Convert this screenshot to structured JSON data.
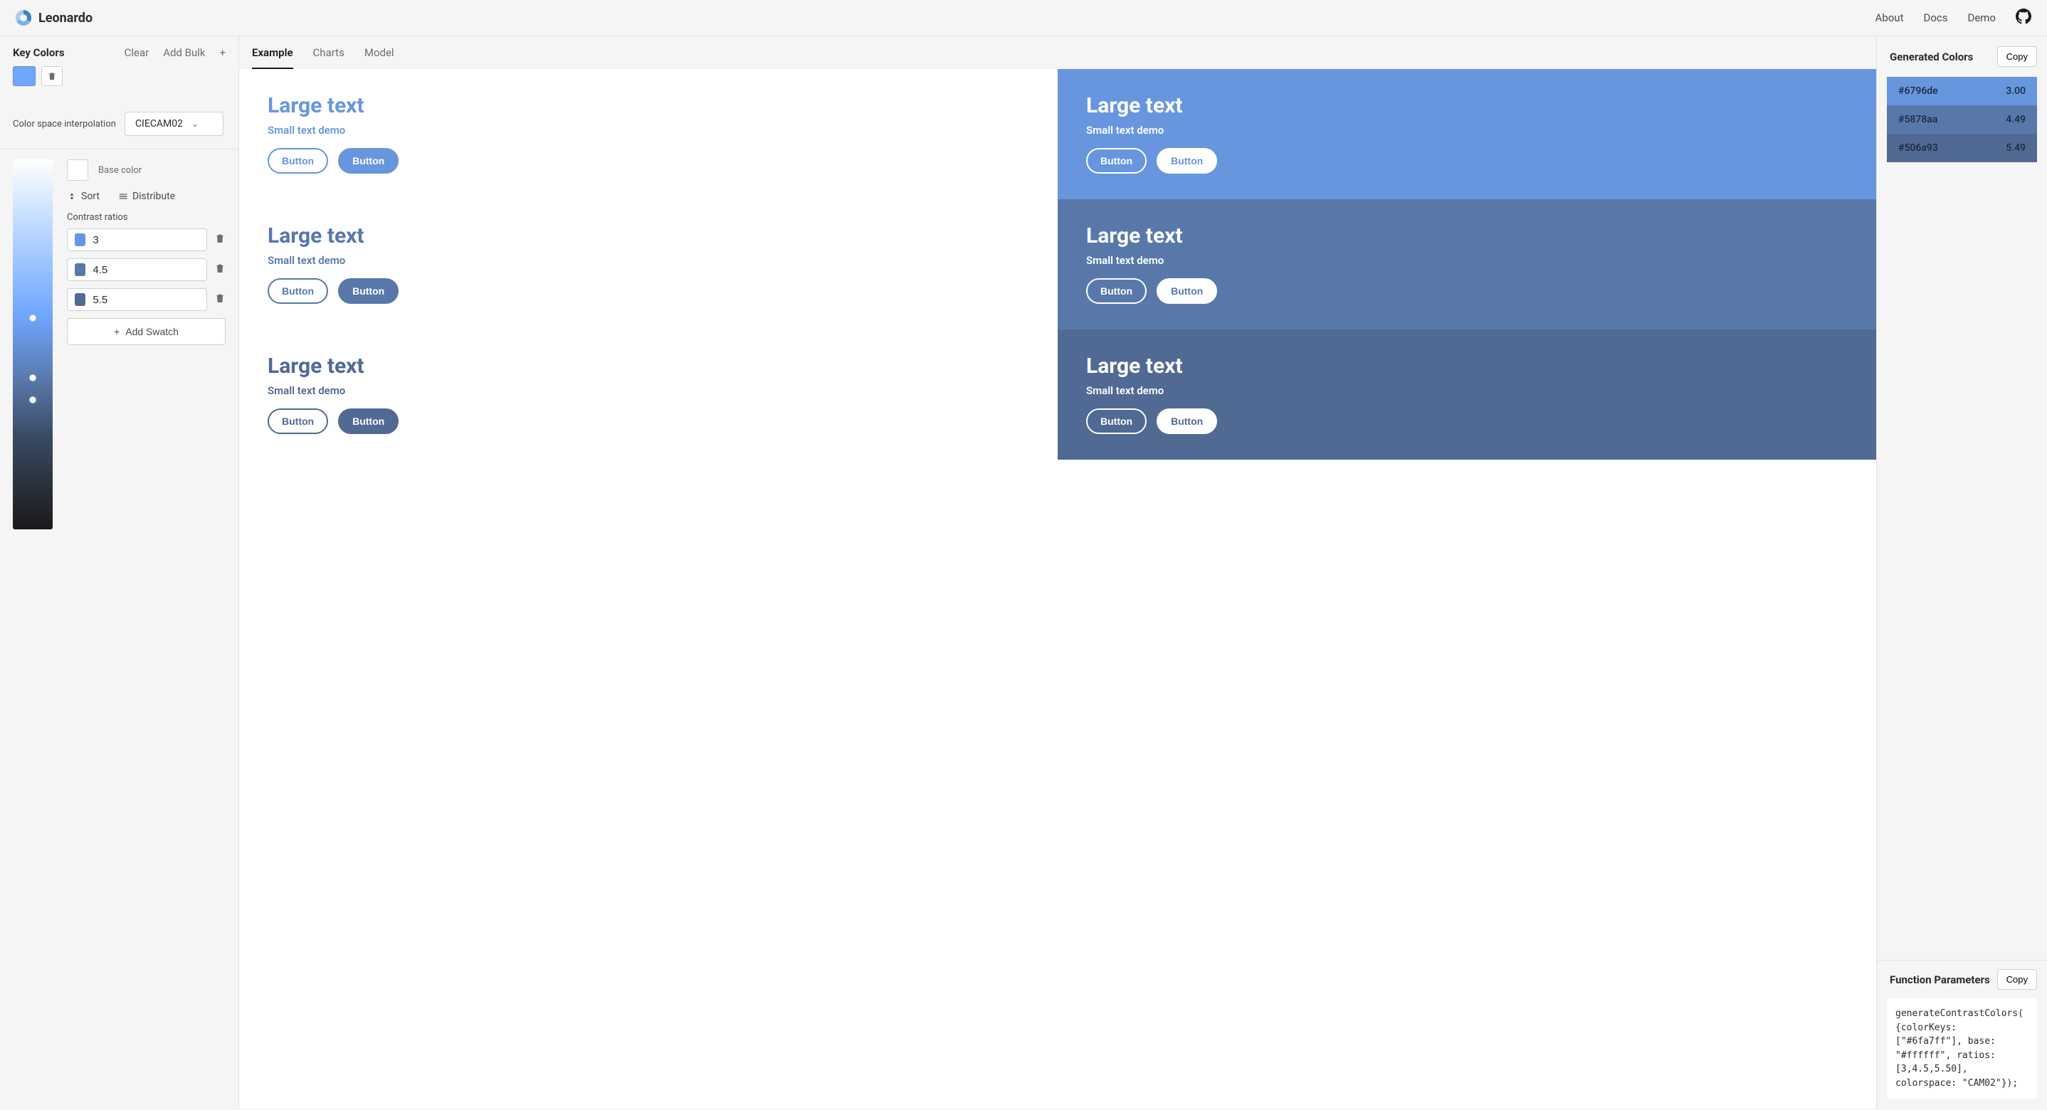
{
  "brand": {
    "name": "Leonardo"
  },
  "topnav": {
    "about": "About",
    "docs": "Docs",
    "demo": "Demo"
  },
  "keycolors": {
    "title": "Key Colors",
    "clear": "Clear",
    "add_bulk": "Add Bulk",
    "swatch_color": "#6fa7ff"
  },
  "colorspace": {
    "label": "Color space interpolation",
    "value": "CIECAM02"
  },
  "base": {
    "label": "Base color",
    "color": "#ffffff"
  },
  "sortdist": {
    "sort": "Sort",
    "distribute": "Distribute"
  },
  "contrast": {
    "label": "Contrast ratios",
    "ratios": [
      {
        "value": "3",
        "color": "#6796de"
      },
      {
        "value": "4.5",
        "color": "#5878aa"
      },
      {
        "value": "5.5",
        "color": "#506a93"
      }
    ],
    "add_swatch": "Add Swatch"
  },
  "gradient_dots": [
    42,
    58,
    64
  ],
  "tabs": {
    "example": "Example",
    "charts": "Charts",
    "model": "Model",
    "active": "example"
  },
  "example": {
    "large": "Large text",
    "small": "Small text demo",
    "button": "Button",
    "colors": [
      "#6796de",
      "#5878aa",
      "#506a93"
    ]
  },
  "generated": {
    "title": "Generated Colors",
    "copy": "Copy",
    "items": [
      {
        "hex": "#6796de",
        "ratio": "3.00"
      },
      {
        "hex": "#5878aa",
        "ratio": "4.49"
      },
      {
        "hex": "#506a93",
        "ratio": "5.49"
      }
    ]
  },
  "funcparams": {
    "title": "Function Parameters",
    "copy": "Copy",
    "code": "generateContrastColors({colorKeys: [\"#6fa7ff\"], base: \"#ffffff\", ratios: [3,4.5,5.50], colorspace: \"CAM02\"});"
  }
}
